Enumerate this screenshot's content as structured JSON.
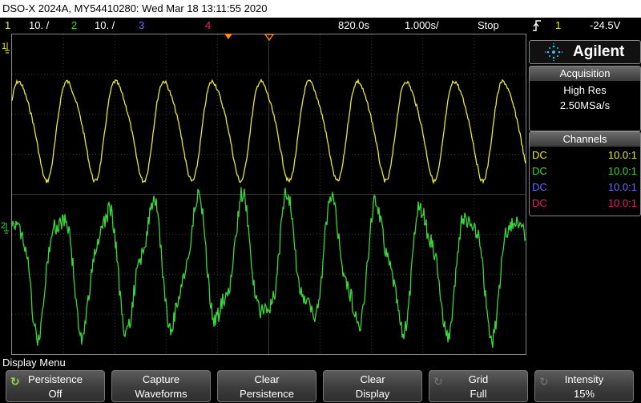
{
  "title": "DSO-X 2024A, MY54410280: Wed Mar 18 13:11:55 2020",
  "status": {
    "ch1_num": "1",
    "ch1_scale": "10. /",
    "ch2_num": "2",
    "ch2_scale": "10. /",
    "ch3_num": "3",
    "ch4_num": "4",
    "delay": "820.0s",
    "timebase": "1.000s/",
    "run_state": "Stop",
    "trigger_icon": "trigger-rising-edge-icon",
    "trigger_channel": "1",
    "trigger_level": "-24.5V"
  },
  "brand": {
    "name": "Agilent",
    "icon": "agilent-spark-logo"
  },
  "acquisition": {
    "header": "Acquisition",
    "mode": "High Res",
    "rate": "2.50MSa/s"
  },
  "channels": {
    "header": "Channels",
    "rows": [
      {
        "coupling": "DC",
        "ratio": "10.0:1",
        "color": "#e8e83a"
      },
      {
        "coupling": "DC",
        "ratio": "10.0:1",
        "color": "#3bd63b"
      },
      {
        "coupling": "DC",
        "ratio": "10.0:1",
        "color": "#6b6bff"
      },
      {
        "coupling": "DC",
        "ratio": "10.0:1",
        "color": "#e8207a"
      }
    ]
  },
  "plot": {
    "ch1_marker": "1",
    "ch2_marker": "2"
  },
  "menu": {
    "label": "Display Menu",
    "keys": [
      {
        "line1": "Persistence",
        "line2": "Off",
        "icon": "rotate-knob-icon"
      },
      {
        "line1": "Capture",
        "line2": "Waveforms",
        "icon": ""
      },
      {
        "line1": "Clear",
        "line2": "Persistence",
        "icon": ""
      },
      {
        "line1": "Clear",
        "line2": "Display",
        "icon": ""
      },
      {
        "line1": "Grid",
        "line2": "Full",
        "icon": "rotate-knob-icon"
      },
      {
        "line1": "Intensity",
        "line2": "15%",
        "icon": "rotate-knob-icon"
      }
    ]
  },
  "colors": {
    "ch1": "#e8e83a",
    "ch2": "#3bd63b",
    "ch3": "#6b6bff",
    "ch4": "#e8207a",
    "trigger_marker": "#ff8c1a"
  }
}
